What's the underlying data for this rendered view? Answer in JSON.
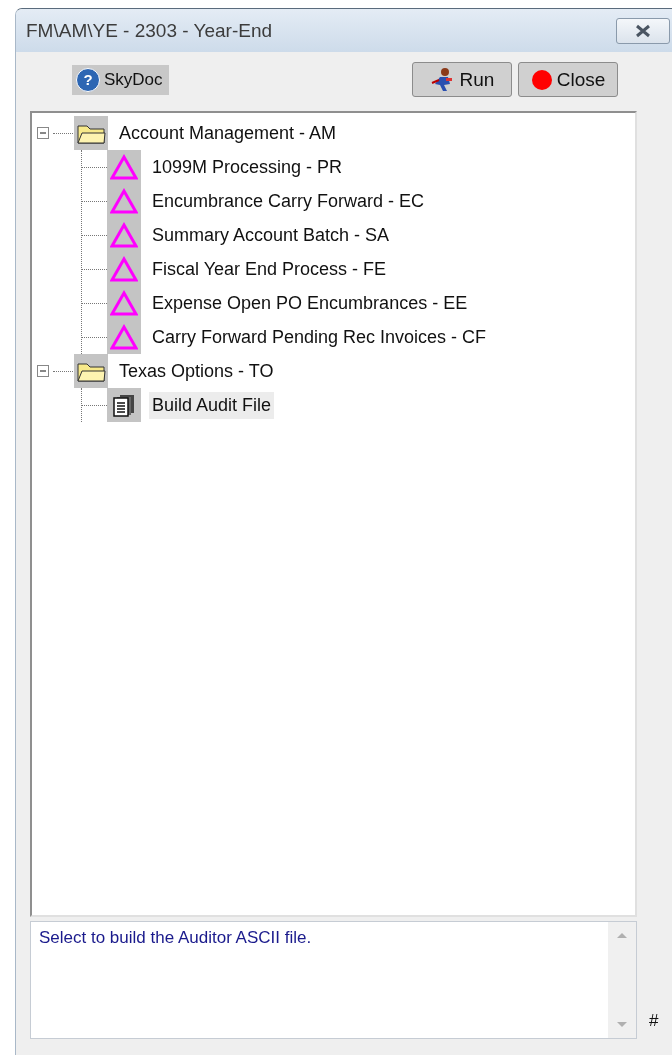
{
  "window": {
    "title": "FM\\AM\\YE - 2303 - Year-End"
  },
  "toolbar": {
    "help": {
      "glyph": "?",
      "label": "SkyDoc"
    },
    "buttons": [
      {
        "kind": "run",
        "label": "Run"
      },
      {
        "kind": "close",
        "label": "Close"
      }
    ]
  },
  "tree": [
    {
      "kind": "folder",
      "label": "Account Management - AM",
      "expanded": true,
      "selected": false,
      "children": [
        {
          "kind": "task",
          "label": "1099M Processing - PR",
          "selected": false
        },
        {
          "kind": "task",
          "label": "Encumbrance Carry Forward - EC",
          "selected": false
        },
        {
          "kind": "task",
          "label": "Summary Account Batch - SA",
          "selected": false
        },
        {
          "kind": "task",
          "label": "Fiscal Year End Process - FE",
          "selected": false
        },
        {
          "kind": "task",
          "label": "Expense Open PO Encumbrances - EE",
          "selected": false
        },
        {
          "kind": "task",
          "label": "Carry Forward Pending Rec Invoices - CF",
          "selected": false
        }
      ]
    },
    {
      "kind": "folder",
      "label": "Texas Options - TO",
      "expanded": true,
      "selected": false,
      "children": [
        {
          "kind": "report",
          "label": "Build Audit File",
          "selected": true
        }
      ]
    }
  ],
  "description": "Select to build the Auditor ASCII file.",
  "corner_mark": "#"
}
